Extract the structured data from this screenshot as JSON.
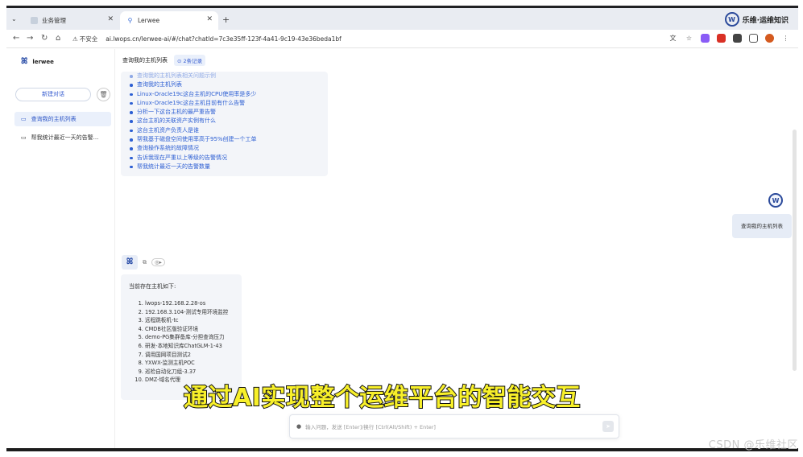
{
  "browser": {
    "tabs": [
      {
        "title": "业务管理"
      },
      {
        "title": "Lerwee"
      }
    ],
    "brand_name": "乐维·运维知识",
    "url_security": "不安全",
    "url": "ai.lwops.cn/lerwee-ai/#/chat?chatId=7c3e35ff-123f-4a41-9c19-43e36beda1bf"
  },
  "sidebar": {
    "logo_text": "lerwee",
    "new_chat_label": "新建对话",
    "items": [
      {
        "label": "查询我的主机列表",
        "active": true
      },
      {
        "label": "帮我统计最近一天的告警...",
        "active": false
      }
    ]
  },
  "chat": {
    "title": "查询我的主机列表",
    "history_badge": "2条记录",
    "suggestions": [
      "查询我的主机列表相关问题示例",
      "查询我的主机列表",
      "Linux-Oracle19c这台主机的CPU使用率是多少",
      "Linux-Oracle19c这台主机目前有什么告警",
      "分析一下这台主机的最严重告警",
      "这台主机的关联资产实例有什么",
      "这台主机资产负责人是谁",
      "帮我基于磁盘空间使用率高于95%创建一个工单",
      "查询操作系统的故障情况",
      "告诉我现在严重以上等级的告警情况",
      "帮我统计最近一天的告警数量"
    ],
    "user_message": "查询我的主机列表",
    "answer_title": "当前存在主机如下:",
    "hosts": [
      "lwops-192.168.2.28-os",
      "192.168.3.104-测试专用环境监控",
      "远程跳板机-tc",
      "CMDB社区版验证环境",
      "demo-PG集群备库-分担查询压力",
      "研发-本地知识库ChatGLM-1-43",
      "调用国网项目测试2",
      "YXWX-监测主机POC",
      "巡检自动化刀组-3.37",
      "DMZ-域名代理"
    ],
    "input_placeholder": "输入问题，发送 [Enter]/换行 [Ctrl(Alt/Shift) + Enter]"
  },
  "overlay": {
    "subtitle": "通过AI实现整个运维平台的智能交互",
    "watermark": "CSDN @乐维社区"
  },
  "colors": {
    "accent": "#2d5fd3",
    "subtitle": "#f8f02a"
  }
}
